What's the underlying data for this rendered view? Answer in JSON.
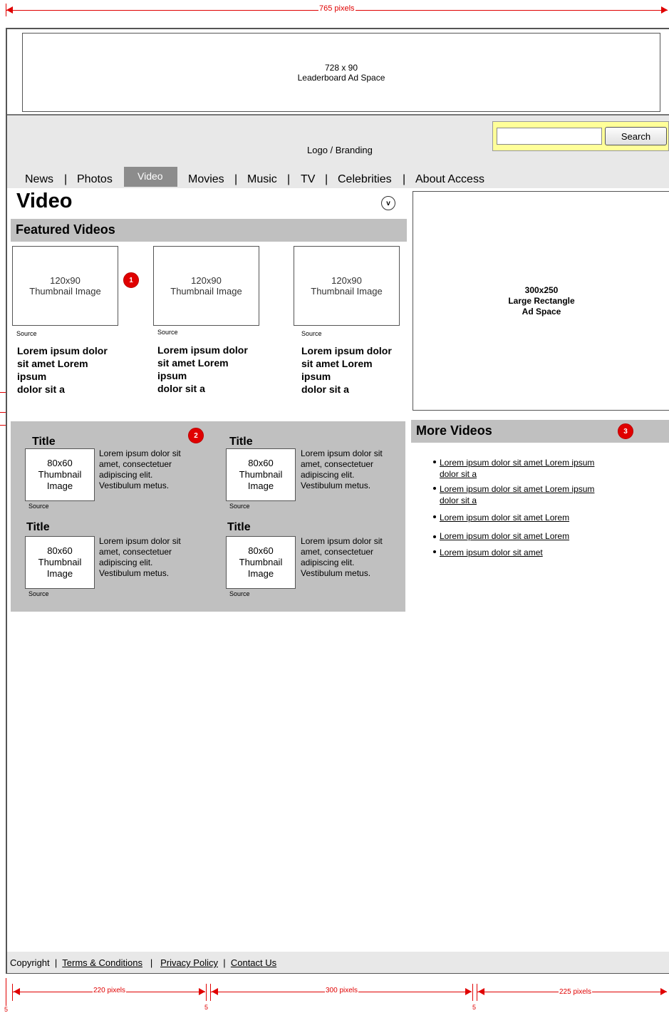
{
  "dimensions": {
    "top_width": "765 pixels",
    "col1": "220 pixels",
    "col2": "300 pixels",
    "col3": "225 pixels",
    "gap1": "5",
    "gap2": "5",
    "gap3": "5"
  },
  "header": {
    "leaderboard_line1": "728 x 90",
    "leaderboard_line2": "Leaderboard Ad Space",
    "logo": "Logo / Branding",
    "search_value": "",
    "search_button": "Search"
  },
  "nav": [
    "News",
    "Photos",
    "Video",
    "Movies",
    "Music",
    "TV",
    "Celebrities",
    "About Access"
  ],
  "nav_separator": "|",
  "page": {
    "title": "Video",
    "toggle_glyph": "v"
  },
  "featured": {
    "heading": "Featured Videos",
    "thumb_line1": "120x90",
    "thumb_line2": "Thumbnail Image",
    "items": [
      {
        "source": "Source",
        "line1": "Lorem ipsum dolor",
        "line2": "sit amet Lorem",
        "line3": "ipsum",
        "line4": "dolor sit a"
      },
      {
        "source": "Source",
        "line1": "Lorem ipsum dolor",
        "line2": "sit amet Lorem",
        "line3": "ipsum",
        "line4": "dolor sit a"
      },
      {
        "source": "Source",
        "line1": "Lorem ipsum dolor",
        "line2": "sit amet Lorem",
        "line3": "ipsum",
        "line4": "dolor sit a"
      }
    ]
  },
  "badges": [
    "1",
    "2",
    "3"
  ],
  "grid": {
    "items": [
      {
        "title": "Title",
        "thumb1": "80x60",
        "thumb2": "Thumbnail",
        "thumb3": "Image",
        "source": "Source",
        "d1": "Lorem ipsum dolor sit",
        "d2": "amet, consectetuer",
        "d3": "adipiscing elit.",
        "d4": "Vestibulum metus."
      },
      {
        "title": "Title",
        "thumb1": "80x60",
        "thumb2": "Thumbnail",
        "thumb3": "Image",
        "source": "Source",
        "d1": "Lorem ipsum dolor sit",
        "d2": "amet, consectetuer",
        "d3": "adipiscing elit.",
        "d4": "Vestibulum metus."
      },
      {
        "title": "Title",
        "thumb1": "80x60",
        "thumb2": "Thumbnail",
        "thumb3": "Image",
        "source": "Source",
        "d1": "Lorem ipsum dolor sit",
        "d2": "amet, consectetuer",
        "d3": "adipiscing elit.",
        "d4": "Vestibulum metus."
      },
      {
        "title": "Title",
        "thumb1": "80x60",
        "thumb2": "Thumbnail",
        "thumb3": "Image",
        "source": "Source",
        "d1": "Lorem ipsum dolor sit",
        "d2": "amet, consectetuer",
        "d3": "adipiscing elit.",
        "d4": "Vestibulum metus."
      }
    ]
  },
  "ad_rect": {
    "line1": "300x250",
    "line2": "Large Rectangle",
    "line3": "Ad Space"
  },
  "more_videos": {
    "heading": "More Videos",
    "links": [
      {
        "l1": "Lorem ipsum dolor sit amet Lorem ipsum",
        "l2": "dolor sit a"
      },
      {
        "l1": "Lorem ipsum dolor sit amet Lorem ipsum",
        "l2": "dolor sit a"
      },
      {
        "l1": "Lorem ipsum dolor sit amet Lorem",
        "l2": ""
      },
      {
        "l1": "Lorem ipsum dolor sit amet Lorem",
        "l2": ""
      },
      {
        "l1": "Lorem ipsum dolor sit amet",
        "l2": ""
      }
    ]
  },
  "footer": {
    "copyright": "Copyright",
    "sep": "|",
    "terms": "Terms & Conditions",
    "privacy": "Privacy Policy",
    "contact": "Contact Us"
  },
  "colors": {
    "annotation_red": "#e00000",
    "band_gray": "#e8e8e8",
    "section_gray": "#c0c0c0",
    "active_tab": "#8c8c8c",
    "search_highlight": "#ffff99"
  }
}
